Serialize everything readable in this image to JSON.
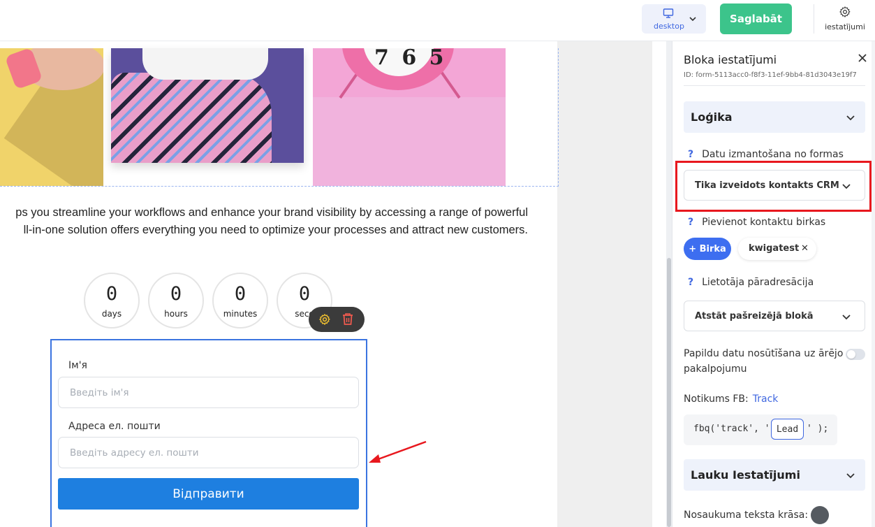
{
  "topbar": {
    "device_label": "desktop",
    "save_label": "Saglabāt",
    "settings_label": "iestatījumi"
  },
  "canvas": {
    "paragraph_lines": [
      "ps you streamline your workflows and enhance your brand visibility by accessing a range of powerful",
      "ll-in-one solution offers everything you need to optimize your processes and attract new customers."
    ],
    "countdown": [
      {
        "value": "0",
        "label": "days"
      },
      {
        "value": "0",
        "label": "hours"
      },
      {
        "value": "0",
        "label": "minutes"
      },
      {
        "value": "0",
        "label": "seco"
      }
    ],
    "clock_digits": "7 6 5",
    "form": {
      "name_label": "Ім'я",
      "name_placeholder": "Введіть ім'я",
      "email_label": "Адреса ел. пошти",
      "email_placeholder": "Введіть адресу ел. пошти",
      "submit_label": "Відправити"
    }
  },
  "panel": {
    "title": "Bloka iestatījumi",
    "id_text": "ID: form-5113acc0-f8f3-11ef-9bb4-81d3043e19f7",
    "logic_section": "Loģika",
    "data_usage_label": "Datu izmantošana no formas",
    "data_usage_value": "Tika izveidots kontakts CRM",
    "tags_label": "Pievienot kontaktu birkas",
    "tag_add_label": "+ Birka",
    "tags": [
      "kwigatest"
    ],
    "redirect_label": "Lietotāja pāradresācija",
    "redirect_value": "Atstāt pašreizējā blokā",
    "external_label_line1": "Papildu datu nosūtīšana uz ārējo",
    "external_label_line2": "pakalpojumu",
    "external_enabled": false,
    "fb_event_label": "Notikums FB:",
    "fb_event_link": "Track",
    "fb_code_prefix": "fbq('track', '",
    "fb_code_value": "Lead",
    "fb_code_suffix": "' );",
    "fields_section": "Lauku Iestatījumi",
    "title_color_label": "Nosaukuma teksta krāsa:",
    "title_color": "#555a60",
    "question_mark": "?"
  },
  "colors": {
    "save_green": "#3cc48b",
    "accent_blue": "#3f67e0",
    "submit_blue": "#1e7fe0",
    "highlight_red": "#e8181e"
  }
}
